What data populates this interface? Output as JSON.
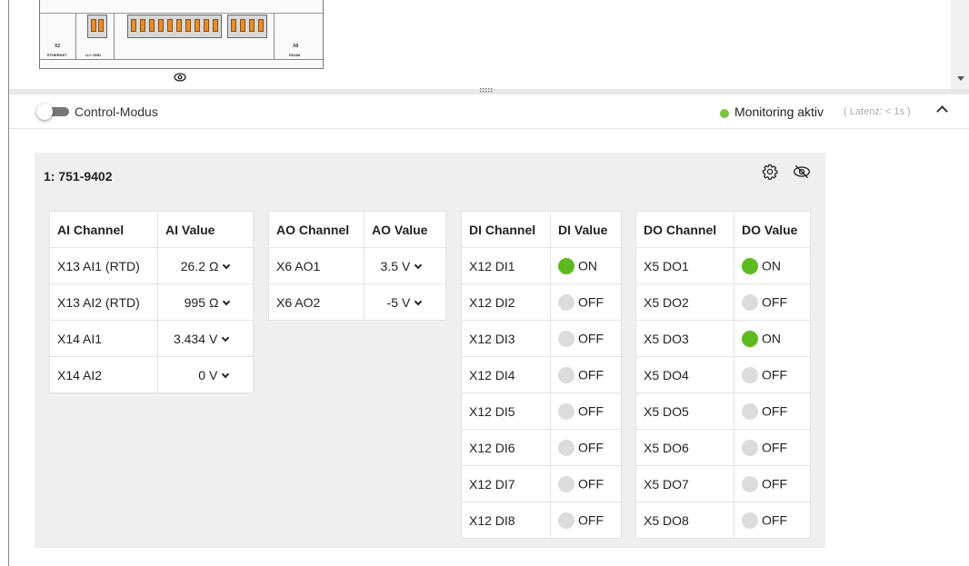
{
  "device_preview": {
    "left_port_label": "X2",
    "left_port_sub": "ETHERNET",
    "power_label": "U₀+ GND",
    "right_port_label": "X8",
    "right_port_sub": "RS485"
  },
  "header": {
    "control_mode_label": "Control-Modus",
    "monitoring_label": "Monitoring aktiv",
    "latency_label": "( Latenz: < 1s )",
    "monitoring_color": "#7dc242"
  },
  "module": {
    "title": "1: 751-9402",
    "ai_table": {
      "headers": [
        "AI Channel",
        "AI Value"
      ],
      "rows": [
        {
          "channel": "X13 AI1 (RTD)",
          "value": "26.2",
          "unit": "Ω"
        },
        {
          "channel": "X13 AI2 (RTD)",
          "value": "995",
          "unit": "Ω"
        },
        {
          "channel": "X14 AI1",
          "value": "3.434",
          "unit": "V"
        },
        {
          "channel": "X14 AI2",
          "value": "0",
          "unit": "V"
        }
      ]
    },
    "ao_table": {
      "headers": [
        "AO Channel",
        "AO Value"
      ],
      "rows": [
        {
          "channel": "X6 AO1",
          "value": "3.5",
          "unit": "V"
        },
        {
          "channel": "X6 AO2",
          "value": "-5",
          "unit": "V"
        }
      ]
    },
    "di_table": {
      "headers": [
        "DI Channel",
        "DI Value"
      ],
      "rows": [
        {
          "channel": "X12 DI1",
          "state": "ON"
        },
        {
          "channel": "X12 DI2",
          "state": "OFF"
        },
        {
          "channel": "X12 DI3",
          "state": "OFF"
        },
        {
          "channel": "X12 DI4",
          "state": "OFF"
        },
        {
          "channel": "X12 DI5",
          "state": "OFF"
        },
        {
          "channel": "X12 DI6",
          "state": "OFF"
        },
        {
          "channel": "X12 DI7",
          "state": "OFF"
        },
        {
          "channel": "X12 DI8",
          "state": "OFF"
        }
      ]
    },
    "do_table": {
      "headers": [
        "DO Channel",
        "DO Value"
      ],
      "rows": [
        {
          "channel": "X5 DO1",
          "state": "ON"
        },
        {
          "channel": "X5 DO2",
          "state": "OFF"
        },
        {
          "channel": "X5 DO3",
          "state": "ON"
        },
        {
          "channel": "X5 DO4",
          "state": "OFF"
        },
        {
          "channel": "X5 DO5",
          "state": "OFF"
        },
        {
          "channel": "X5 DO6",
          "state": "OFF"
        },
        {
          "channel": "X5 DO7",
          "state": "OFF"
        },
        {
          "channel": "X5 DO8",
          "state": "OFF"
        }
      ]
    },
    "colors": {
      "on": "#5dbb1f",
      "off": "#dcdcdc"
    }
  }
}
